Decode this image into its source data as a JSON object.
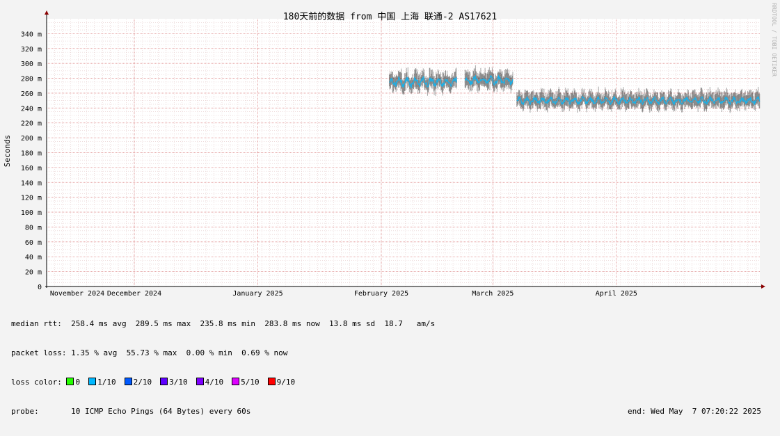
{
  "chart_data": {
    "type": "line",
    "title": "180天前的数据 from 中国 上海 联通-2 AS17621",
    "ylabel": "Seconds",
    "ylim": [
      0,
      360
    ],
    "y_ticks": [
      {
        "value": 0,
        "label": "0"
      },
      {
        "value": 20,
        "label": "20 m"
      },
      {
        "value": 40,
        "label": "40 m"
      },
      {
        "value": 60,
        "label": "60 m"
      },
      {
        "value": 80,
        "label": "80 m"
      },
      {
        "value": 100,
        "label": "100 m"
      },
      {
        "value": 120,
        "label": "120 m"
      },
      {
        "value": 140,
        "label": "140 m"
      },
      {
        "value": 160,
        "label": "160 m"
      },
      {
        "value": 180,
        "label": "180 m"
      },
      {
        "value": 200,
        "label": "200 m"
      },
      {
        "value": 220,
        "label": "220 m"
      },
      {
        "value": 240,
        "label": "240 m"
      },
      {
        "value": 260,
        "label": "260 m"
      },
      {
        "value": 280,
        "label": "280 m"
      },
      {
        "value": 300,
        "label": "300 m"
      },
      {
        "value": 320,
        "label": "320 m"
      },
      {
        "value": 340,
        "label": "340 m"
      }
    ],
    "x_range": [
      "2024-11-09",
      "2025-05-07"
    ],
    "x_ticks": [
      {
        "date": "2024-11-01",
        "label": "November 2024"
      },
      {
        "date": "2024-12-01",
        "label": "December 2024"
      },
      {
        "date": "2025-01-01",
        "label": "January 2025"
      },
      {
        "date": "2025-02-01",
        "label": "February 2025"
      },
      {
        "date": "2025-03-01",
        "label": "March 2025"
      },
      {
        "date": "2025-04-01",
        "label": "April 2025"
      }
    ],
    "grid": true,
    "series": [
      {
        "smoke_color": "#000000",
        "median_color": "#1ab0e8",
        "segments": [
          {
            "start": "2025-02-03",
            "end": "2025-02-20",
            "median": 275,
            "jitter": 7,
            "smoke": 12
          },
          {
            "start": "2025-02-22",
            "end": "2025-03-06",
            "median": 277,
            "jitter": 6,
            "smoke": 12
          },
          {
            "start": "2025-03-07",
            "end": "2025-05-07",
            "median": 250,
            "jitter": 5,
            "smoke": 11
          }
        ]
      }
    ]
  },
  "legend": {
    "median_rtt": "median rtt:  258.4 ms avg  289.5 ms max  235.8 ms min  283.8 ms now  13.8 ms sd  18.7   am/s",
    "packet_loss": "packet loss: 1.35 % avg  55.73 % max  0.00 % min  0.69 % now",
    "loss_color_label": "loss color: ",
    "loss_colors": [
      {
        "label": "0",
        "color": "#26ff00"
      },
      {
        "label": "1/10",
        "color": "#00b8ff"
      },
      {
        "label": "2/10",
        "color": "#0059ff"
      },
      {
        "label": "3/10",
        "color": "#5e00ff"
      },
      {
        "label": "4/10",
        "color": "#7e00ff"
      },
      {
        "label": "5/10",
        "color": "#dd00ff"
      },
      {
        "label": "9/10",
        "color": "#ff0000"
      }
    ],
    "probe": "probe:       10 ICMP Echo Pings (64 Bytes) every 60s",
    "end": "end: Wed May  7 07:20:22 2025"
  },
  "watermark": "RRDTOOL / TOBI OETIKER"
}
